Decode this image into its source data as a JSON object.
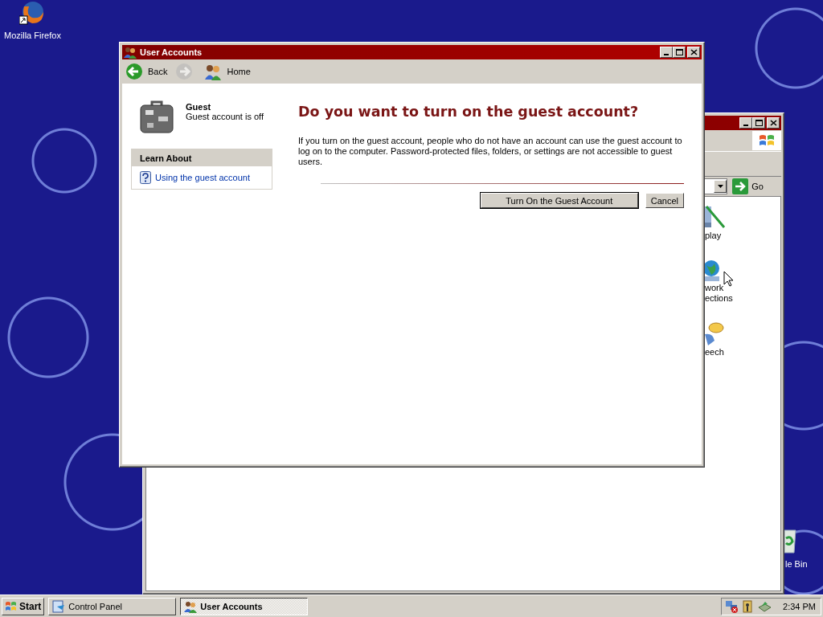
{
  "desktop_icons": [
    {
      "kind": "firefox",
      "label": "Mozilla Firefox"
    },
    {
      "kind": "bin",
      "label": "le Bin"
    }
  ],
  "background_window": {
    "go_button": "Go",
    "items": [
      {
        "kind": "display",
        "lines": [
          "play"
        ]
      },
      {
        "kind": "network",
        "lines": [
          "work",
          "ections"
        ]
      },
      {
        "kind": "speech",
        "lines": [
          "eech"
        ]
      }
    ]
  },
  "window": {
    "title": "User Accounts",
    "toolbar": [
      {
        "kind": "back",
        "label": "Back",
        "disabled": false
      },
      {
        "kind": "forward",
        "disabled": true
      },
      {
        "kind": "home",
        "label": "Home",
        "disabled": false
      }
    ],
    "account": {
      "name": "Guest",
      "status": "Guest account is off"
    },
    "learn_about": {
      "title": "Learn About",
      "links": [
        "Using the guest account"
      ]
    },
    "heading": "Do you want to turn on the guest account?",
    "description": "If you turn on the guest account, people who do not have an account can use the guest account to log on to the computer. Password-protected files, folders, or settings are not accessible to guest users.",
    "buttons": [
      {
        "kind": "primary",
        "label": "Turn On the Guest Account"
      },
      {
        "kind": "secondary",
        "label": "Cancel"
      }
    ]
  },
  "taskbar": {
    "start": "Start",
    "tasks": [
      {
        "kind": "control-panel",
        "label": "Control Panel",
        "selected": false
      },
      {
        "kind": "users",
        "label": "User Accounts",
        "selected": true
      }
    ],
    "clock": "2:34 PM"
  }
}
